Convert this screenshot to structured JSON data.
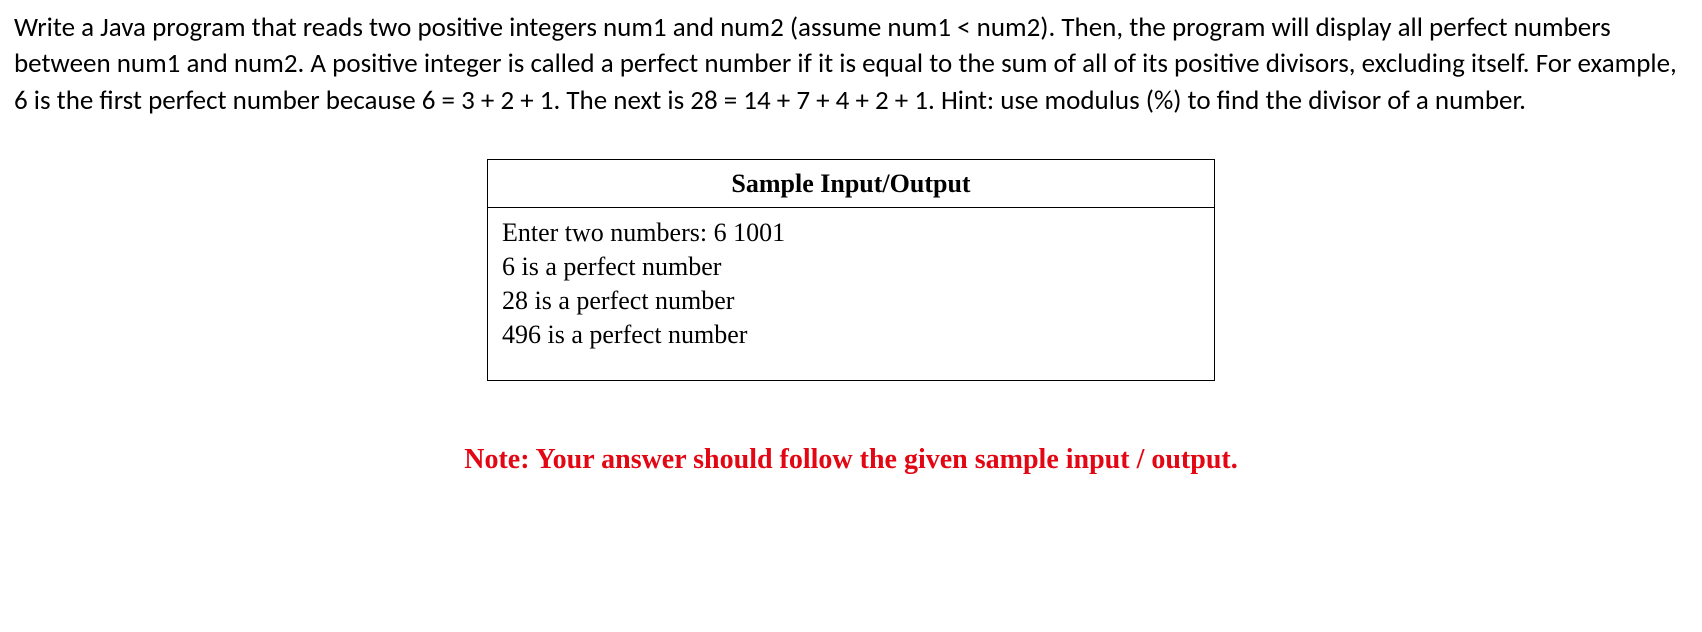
{
  "question": {
    "text": "Write a Java program  that reads two positive integers num1 and num2 (assume num1 < num2). Then, the program will display all perfect numbers between num1 and num2. A positive integer is called a perfect number if it is equal to the sum of all of its positive divisors, excluding itself. For example, 6 is the first perfect number because 6 = 3 + 2 + 1. The next is 28 = 14 + 7 + 4 + 2 + 1. Hint: use modulus (%) to find the divisor of a number."
  },
  "sample": {
    "header": "Sample Input/Output",
    "lines": [
      "Enter two numbers: 6  1001",
      "6 is a perfect number",
      "28 is a perfect number",
      "496 is a perfect number"
    ]
  },
  "note": "Note: Your answer should follow the given sample input / output."
}
